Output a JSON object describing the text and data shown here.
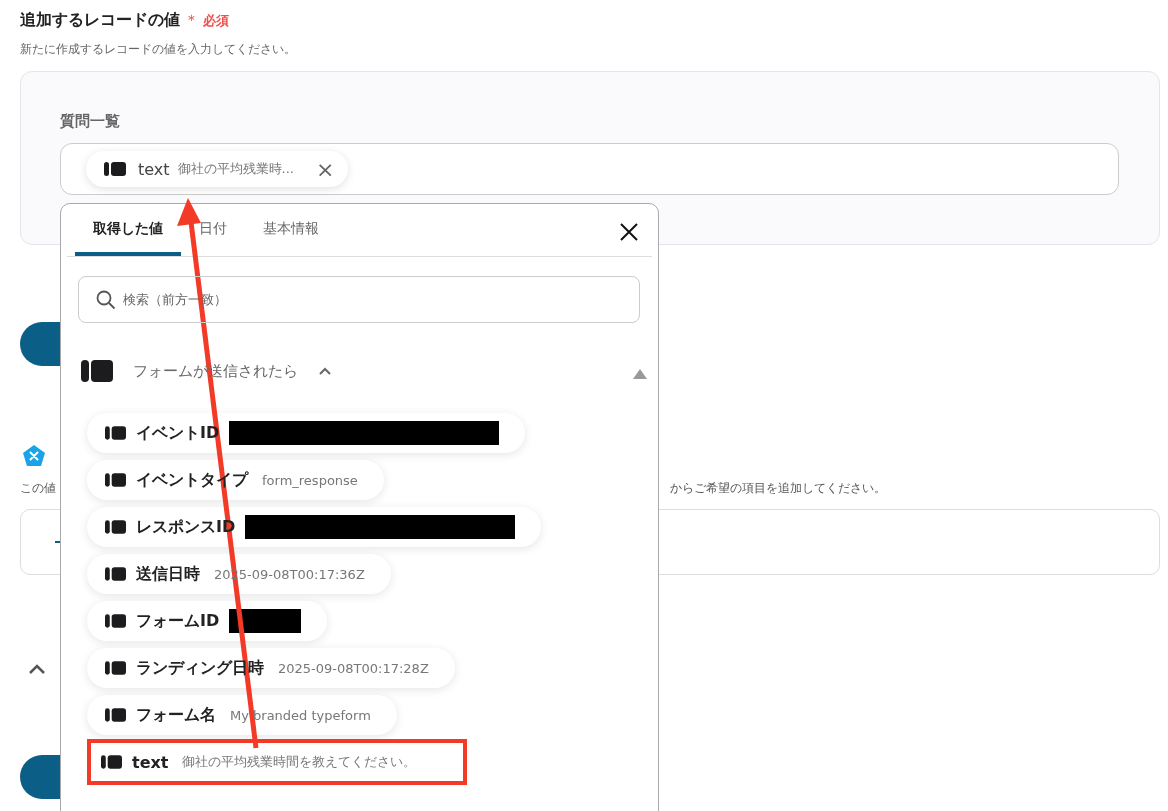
{
  "section": {
    "title": "追加するレコードの値",
    "required_mark": "＊",
    "required_label": "必須",
    "description": "新たに作成するレコードの値を入力してください。"
  },
  "question_list": {
    "label": "質問一覧",
    "chip": {
      "name": "text",
      "value": "御社の平均残業時...",
      "close": "×"
    }
  },
  "background": {
    "description_left": "この値",
    "description_right": "からご希望の項目を追加してください。"
  },
  "popup": {
    "tabs": [
      {
        "label": "取得した値",
        "selected": true
      },
      {
        "label": "日付",
        "selected": false
      },
      {
        "label": "基本情報",
        "selected": false
      }
    ],
    "search": {
      "placeholder": "検索（前方一致）"
    },
    "group": {
      "title": "フォームが送信されたら",
      "expanded": true
    },
    "items": [
      {
        "label": "イベントID",
        "kind": "redactedlong",
        "highlighted": false
      },
      {
        "label": "イベントタイプ",
        "value": "form_response",
        "highlighted": false
      },
      {
        "label": "レスポンスID",
        "kind": "redactedlong",
        "highlighted": false
      },
      {
        "label": "送信日時",
        "value": "2025-09-08T00:17:36Z",
        "highlighted": false
      },
      {
        "label": "フォームID",
        "kind": "redactedshort",
        "highlighted": false
      },
      {
        "label": "ランディング日時",
        "value": "2025-09-08T00:17:28Z",
        "highlighted": false
      },
      {
        "label": "フォーム名",
        "value": "My branded typeform",
        "highlighted": false
      },
      {
        "label": "text",
        "value": "御社の平均残業時間を教えてください。",
        "highlighted": true
      }
    ]
  }
}
